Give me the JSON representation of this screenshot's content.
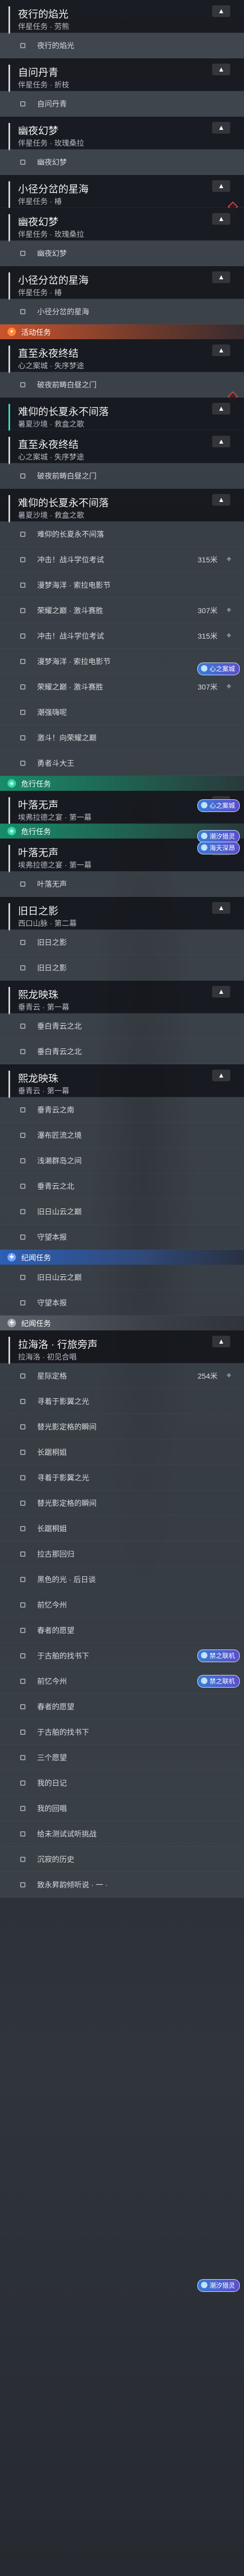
{
  "sections": {
    "activity": "活动任务",
    "companion": "危行任务",
    "legend": "纪闻任务"
  },
  "quests": [
    {
      "title": "夜行的焰光",
      "sub": "伴星任务 · 劳熊"
    },
    {
      "title": "自问丹青",
      "sub": "伴星任务 · 折枝"
    },
    {
      "title": "幽夜幻梦",
      "sub": "伴星任务 · 玫瑰桑拉"
    },
    {
      "title": "小径分岔的星海",
      "sub": "伴星任务 · 椿"
    },
    {
      "title": "幽夜幻梦",
      "sub": "伴星任务 · 玫瑰桑拉"
    },
    {
      "title": "小径分岔的星海",
      "sub": "伴星任务 · 椿"
    },
    {
      "title": "直至永夜终结",
      "sub": "心之案城 · 失序梦途"
    },
    {
      "title": "难仰的长夏永不间落",
      "sub": "暑夏沙境 · 救盒之歌"
    },
    {
      "title": "直至永夜终结",
      "sub": "心之案城 · 失序梦途"
    },
    {
      "title": "难仰的长夏永不间落",
      "sub": "暑夏沙境 · 救盒之歌"
    },
    {
      "title": "叶落无声",
      "sub": "埃弗拉德之宴 · 第一幕"
    },
    {
      "title": "叶落无声",
      "sub": "埃弗拉德之宴 · 第一幕"
    },
    {
      "title": "旧日之影",
      "sub": "西口山脉 · 第二幕"
    },
    {
      "title": "熙龙映珠",
      "sub": "垂青云 · 第一幕"
    },
    {
      "title": "熙龙映珠",
      "sub": "垂青云 · 第一幕"
    },
    {
      "title": "拉海洛 · 行旅旁声",
      "sub": "拉海洛 · 初见合唱"
    }
  ],
  "objectives": [
    {
      "text": "夜行的焰光"
    },
    {
      "text": "自问丹青"
    },
    {
      "text": "幽夜幻梦"
    },
    {
      "text": "小径分岔的星海"
    },
    {
      "text": "幽夜幻梦"
    },
    {
      "text": "小径分岔的星海"
    },
    {
      "text": "破夜前畴白昼之门"
    },
    {
      "text": "破夜前畴白昼之门"
    },
    {
      "text": "难仰的长夏永不间落"
    },
    {
      "text": "冲击！战斗学位考试",
      "dist": "315米"
    },
    {
      "text": "漫梦海洋 · 索拉电影节"
    },
    {
      "text": "荣耀之巅 · 激斗赛胜",
      "dist": "307米"
    },
    {
      "text": "冲击！战斗学位考试",
      "dist": "315米"
    },
    {
      "text": "漫梦海洋 · 索拉电影节"
    },
    {
      "text": "荣耀之巅 · 激斗赛胜",
      "dist": "307米"
    },
    {
      "text": "潮强嗨呢"
    },
    {
      "text": "激斗！向荣耀之巅"
    },
    {
      "text": "勇者斗大王"
    },
    {
      "text": "叶落无声"
    },
    {
      "text": "旧日之影"
    },
    {
      "text": "旧日之影"
    },
    {
      "text": "垂白青云之北"
    },
    {
      "text": "垂白青云之北"
    },
    {
      "text": "垂青云之南"
    },
    {
      "text": "瀑布匠流之境"
    },
    {
      "text": "浅濑群岛之间"
    },
    {
      "text": "垂青云之北"
    },
    {
      "text": "旧日山云之巅"
    },
    {
      "text": "守望本报"
    },
    {
      "text": "旧日山云之巅"
    },
    {
      "text": "守望本报"
    },
    {
      "text": "星际定格",
      "dist": "254米"
    },
    {
      "text": "寻着于影翼之光"
    },
    {
      "text": "替光影定格的瞬间"
    },
    {
      "text": "长踞桐姐"
    },
    {
      "text": "寻着于影翼之光"
    },
    {
      "text": "替光影定格的瞬间"
    },
    {
      "text": "长踞桐姐"
    },
    {
      "text": "拉古那回归"
    },
    {
      "text": "黑色的光 · 后日谈"
    },
    {
      "text": "前忆今州"
    },
    {
      "text": "春者的愿望"
    },
    {
      "text": "于古舶的找书下"
    },
    {
      "text": "前忆今州"
    },
    {
      "text": "春者的愿望"
    },
    {
      "text": "于古舶的找书下"
    },
    {
      "text": "三个愿望"
    },
    {
      "text": "我的日记"
    },
    {
      "text": "我的回唱"
    },
    {
      "text": "给未测试试听挑战"
    },
    {
      "text": "沉寂的历史"
    },
    {
      "text": "致永昇韵倾听说 · 一 ·"
    }
  ],
  "badges": {
    "heart_city": "心之案城",
    "forbidden": "禁之联机",
    "deep_sea": "海天深昂",
    "cai": "潮汐猎灵"
  },
  "icons": {
    "pin": "pin-icon",
    "chevron": "chevron-up-icon",
    "gear": "locate-icon",
    "section": "section-icon"
  },
  "colors": {
    "activity": "#c9532b",
    "companion": "#178c6a",
    "legend": "#2e5fb5",
    "tracked": "#3ee0b6"
  }
}
